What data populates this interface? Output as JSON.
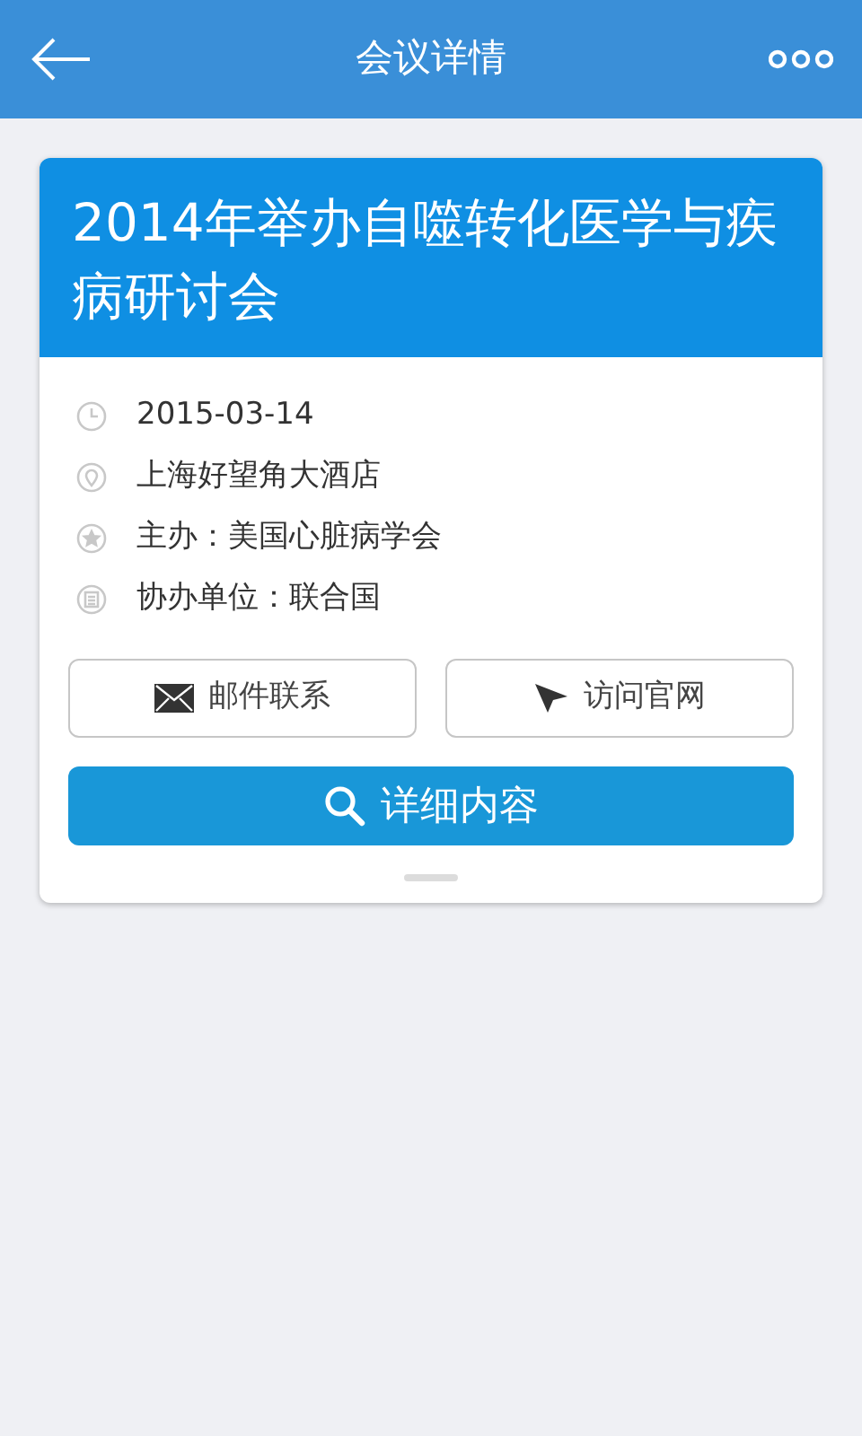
{
  "header": {
    "title": "会议详情"
  },
  "meeting": {
    "title": "2014年举办自噬转化医学与疾病研讨会",
    "info": [
      {
        "kind": "date",
        "text": "2015-03-14"
      },
      {
        "kind": "location",
        "text": "上海好望角大酒店"
      },
      {
        "kind": "host",
        "text": "主办：美国心脏病学会"
      },
      {
        "kind": "cohost",
        "text": "协办单位：联合国"
      }
    ],
    "actions": [
      {
        "kind": "mail",
        "label": "邮件联系"
      },
      {
        "kind": "web",
        "label": "访问官网"
      }
    ],
    "detail_button": "详细内容"
  }
}
